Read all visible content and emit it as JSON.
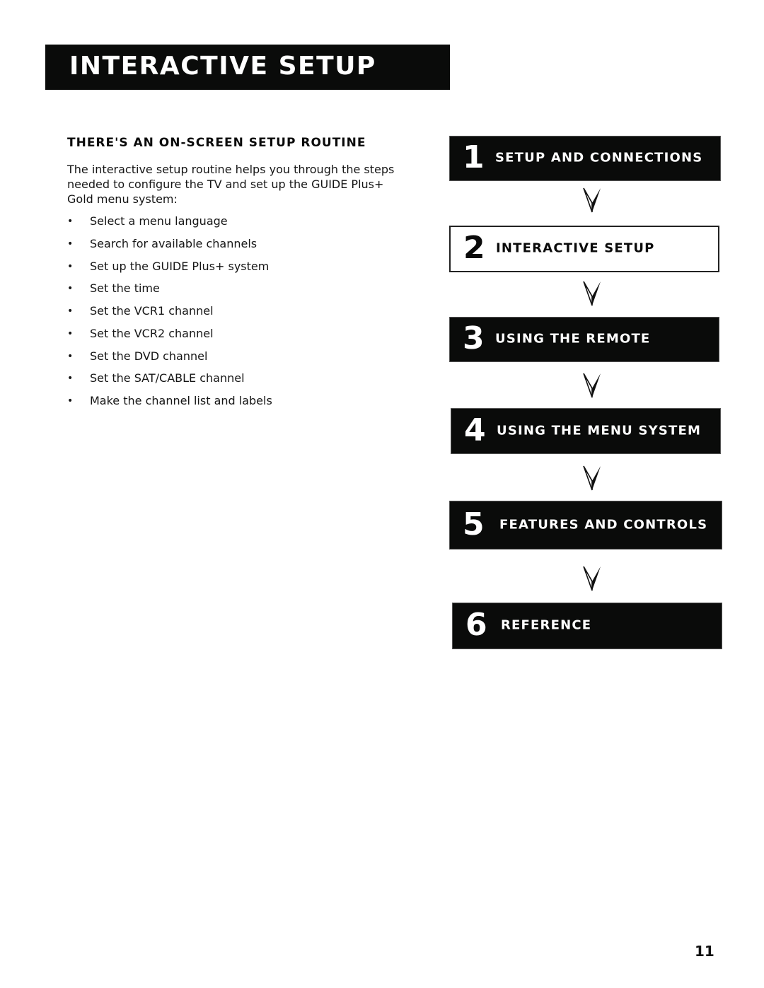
{
  "header": {
    "title": "Interactive Setup"
  },
  "section": {
    "heading": "There's an On-Screen Setup Routine",
    "intro": "The interactive setup routine helps you through the steps needed to configure the TV and set up the GUIDE Plus+ Gold menu system:",
    "bullet_glyph": "•",
    "items": [
      "Select a menu language",
      "Search for available channels",
      "Set up the GUIDE Plus+ system",
      "Set the time",
      "Set the VCR1 channel",
      "Set the VCR2 channel",
      "Set the DVD channel",
      "Set the SAT/CABLE channel",
      "Make the channel list and labels"
    ]
  },
  "steps": [
    {
      "number": "1",
      "label": "Setup and Connections",
      "current": false
    },
    {
      "number": "2",
      "label": "Interactive Setup",
      "current": true
    },
    {
      "number": "3",
      "label": "Using the Remote",
      "current": false
    },
    {
      "number": "4",
      "label": "Using the Menu System",
      "current": false
    },
    {
      "number": "5",
      "label": "Features and Controls",
      "current": false
    },
    {
      "number": "6",
      "label": "Reference",
      "current": false
    }
  ],
  "arrow_icon": "down-arrowhead-icon",
  "page_number": "11"
}
